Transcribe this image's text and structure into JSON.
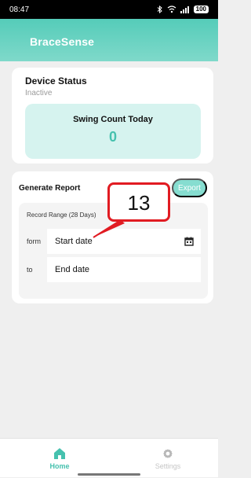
{
  "status_bar": {
    "time": "08:47",
    "battery": "100"
  },
  "app": {
    "title": "BraceSense"
  },
  "device_status": {
    "title": "Device Status",
    "state": "Inactive",
    "swing_title": "Swing Count Today",
    "swing_count": "0"
  },
  "report": {
    "title": "Generate Report",
    "export_label": "Export",
    "range_label": "Record Range (28 Days)",
    "from_label": "form",
    "to_label": "to",
    "start_placeholder": "Start date",
    "end_placeholder": "End date"
  },
  "callout": {
    "number": "13"
  },
  "bottom_nav": {
    "home_label": "Home",
    "settings_label": "Settings"
  },
  "colors": {
    "accent": "#46c1ae",
    "header_start": "#55ccb9",
    "header_end": "#7fd9ca",
    "swing_box": "#d6f3ef",
    "export_button": "#86ddd0",
    "callout": "#e11b22"
  },
  "icons": {
    "bluetooth": "bluetooth-icon",
    "wifi": "wifi-icon",
    "signal": "signal-icon",
    "battery": "battery-icon",
    "calendar": "calendar-icon",
    "home": "home-icon",
    "settings": "gear-icon"
  }
}
